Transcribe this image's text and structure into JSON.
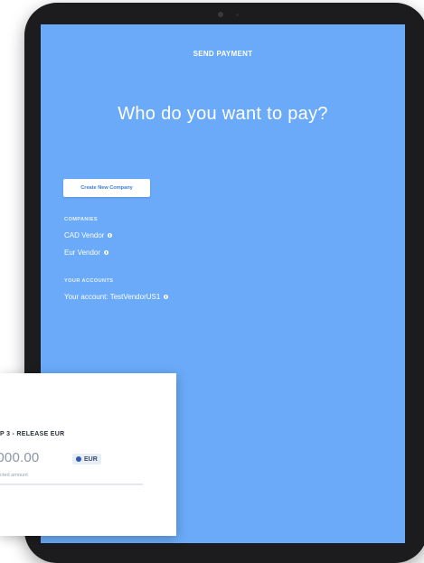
{
  "screen": {
    "send_title": "SEND PAYMENT",
    "heading": "Who do you want to pay?",
    "create_button": "Create New Company",
    "companies_label": "COMPANIES",
    "companies": [
      {
        "name": "CAD Vendor",
        "icon": "info-icon"
      },
      {
        "name": "Eur Vendor",
        "icon": "info-icon"
      }
    ],
    "accounts_label": "YOUR ACCOUNTS",
    "accounts": [
      {
        "name": "Your account: TestVendorUS1",
        "icon": "info-icon"
      }
    ]
  },
  "card": {
    "step": "P 3 - RELEASE EUR",
    "amount": ",000.00",
    "currency": "EUR",
    "currency_icon": "eu-flag-icon",
    "subtitle": "cted amount"
  },
  "colors": {
    "screen_bg": "#6aaaf8",
    "button_text": "#3a7fd8"
  }
}
